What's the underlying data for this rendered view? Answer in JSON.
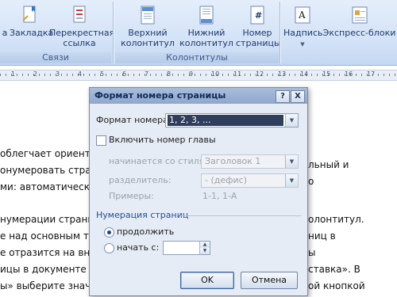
{
  "ribbon": {
    "links_group": {
      "label": "Связи",
      "items": [
        {
          "label": "а",
          "icon": "hyperlink-icon"
        },
        {
          "label": "Закладка",
          "icon": "bookmark-icon"
        },
        {
          "label_line1": "Перекрестная",
          "label_line2": "ссылка",
          "icon": "cross-reference-icon"
        }
      ]
    },
    "header_footer_group": {
      "label": "Колонтитулы",
      "items": [
        {
          "label_line1": "Верхний",
          "label_line2": "колонтитул",
          "icon": "header-icon"
        },
        {
          "label_line1": "Нижний",
          "label_line2": "колонтитул",
          "icon": "footer-icon"
        },
        {
          "label_line1": "Номер",
          "label_line2": "страницы",
          "icon": "page-number-icon"
        }
      ]
    },
    "text_group": {
      "items": [
        {
          "label": "Надпись",
          "icon": "text-box-icon"
        },
        {
          "label": "Экспресс-блоки",
          "icon": "quick-parts-icon"
        }
      ]
    }
  },
  "ruler": {
    "numbers": [
      "1",
      "2",
      "3",
      "4",
      "5",
      "6",
      "7",
      "8",
      "9",
      "10",
      "11",
      "12",
      "13",
      "14",
      "15",
      "16",
      "17"
    ]
  },
  "document": {
    "lines": [
      "облегчает ориентир",
      "онумеровать стран",
      "ми: автоматически",
      "нумерации страниц",
      "е над основным тек",
      "е отразится на внеш",
      "ицы в документе W",
      "ы» выберите значо"
    ],
    "right_fragments": [
      "льный и",
      "о",
      "олонтитул.",
      "ниц в",
      "ы",
      "ставка». В",
      "ой кнопкой"
    ]
  },
  "dialog": {
    "title": "Формат номера страницы",
    "help_button": "?",
    "close_button": "X",
    "number_format_label": "Формат номера:",
    "number_format_value": "1, 2, 3, ...",
    "include_chapter_label": "Включить номер главы",
    "chapter_style_label": "начинается со стиля:",
    "chapter_style_value": "Заголовок 1",
    "separator_label": "разделитель:",
    "separator_value": "-     (дефис)",
    "examples_label": "Примеры:",
    "examples_value": "1-1, 1-А",
    "numbering_group_title": "Нумерация страниц",
    "continue_label": "продолжить",
    "start_at_label": "начать с:",
    "start_at_value": "",
    "ok_label": "OK",
    "cancel_label": "Отмена"
  },
  "colors": {
    "ribbon_bg": "#d4e3f7",
    "dialog_bg": "#e6ecf5",
    "title_bar": "#8fa7cc",
    "selected_combo": "#2f3e5c",
    "group_title": "#1c4fa0"
  }
}
